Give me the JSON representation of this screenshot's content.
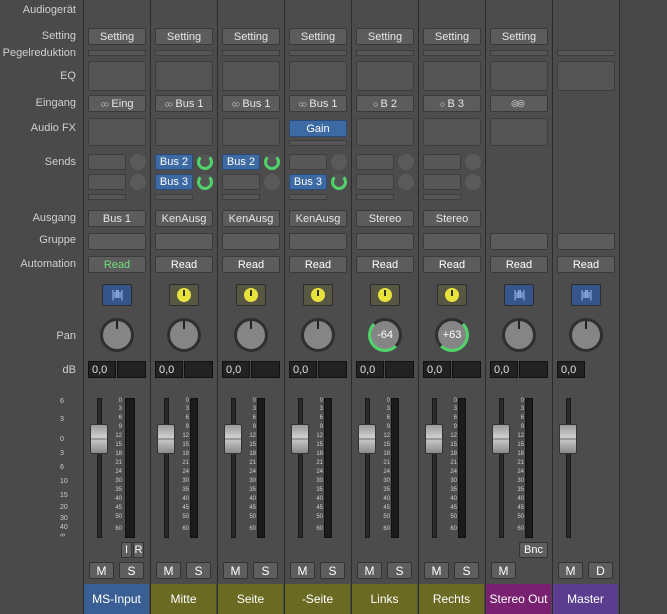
{
  "row_labels": [
    "Audiogerät",
    "Setting",
    "Pegelreduktion",
    "EQ",
    "Eingang",
    "Audio FX",
    "Sends",
    "Ausgang",
    "Gruppe",
    "Automation",
    "Pan",
    "dB"
  ],
  "left_scale": [
    "6",
    "3",
    "0",
    "3",
    "6",
    "10",
    "15",
    "20",
    "30",
    "40",
    "∞"
  ],
  "meter_scale": [
    "0",
    "3",
    "6",
    "9",
    "12",
    "15",
    "18",
    "21",
    "24",
    "30",
    "35",
    "40",
    "45",
    "50",
    "60"
  ],
  "channels": [
    {
      "name": "MS-Input",
      "name_color": "#3a5f95",
      "setting": "Setting",
      "input": "Eing",
      "input_link": "stereo",
      "sends": [],
      "output": "Bus 1",
      "automation": "Read",
      "automation_green": true,
      "plugin": "waveform-icon",
      "pan": "",
      "db": "0,0",
      "m": "M",
      "s": "S",
      "extra1": "I",
      "extra2": "R"
    },
    {
      "name": "Mitte",
      "name_color": "#6a6a22",
      "setting": "Setting",
      "input": "Bus 1",
      "input_link": "linked",
      "sends": [
        "Bus 2",
        "Bus 3"
      ],
      "output": "KenAusg",
      "automation": "Read",
      "automation_green": false,
      "plugin": "tuner-icon",
      "pan": "",
      "db": "0,0",
      "m": "M",
      "s": "S"
    },
    {
      "name": "Seite",
      "name_color": "#6a6a22",
      "setting": "Setting",
      "input": "Bus 1",
      "input_link": "linked",
      "sends": [
        "Bus 2"
      ],
      "output": "KenAusg",
      "automation": "Read",
      "automation_green": false,
      "plugin": "tuner-icon",
      "pan": "",
      "db": "0,0",
      "m": "M",
      "s": "S"
    },
    {
      "name": "-Seite",
      "name_color": "#6a6a22",
      "setting": "Setting",
      "input": "Bus 1",
      "input_link": "linked",
      "sends": [
        "",
        "Bus 3"
      ],
      "output": "KenAusg",
      "automation": "Read",
      "automation_green": false,
      "plugin": "tuner-icon",
      "pan": "",
      "db": "0,0",
      "m": "M",
      "s": "S",
      "fx": "Gain"
    },
    {
      "name": "Links",
      "name_color": "#6a6a22",
      "setting": "Setting",
      "input": "B 2",
      "input_link": "mono",
      "sends": [],
      "output": "Stereo",
      "automation": "Read",
      "automation_green": false,
      "plugin": "tuner-icon",
      "pan": "-64",
      "db": "0,0",
      "m": "M",
      "s": "S"
    },
    {
      "name": "Rechts",
      "name_color": "#6a6a22",
      "setting": "Setting",
      "input": "B 3",
      "input_link": "mono",
      "sends": [],
      "output": "Stereo",
      "automation": "Read",
      "automation_green": false,
      "plugin": "tuner-icon",
      "pan": "+63",
      "db": "0,0",
      "m": "M",
      "s": "S"
    },
    {
      "name": "Stereo Out",
      "name_color": "#7a2070",
      "setting": "Setting",
      "input": "",
      "input_link": "stereo",
      "sends": [],
      "output": "",
      "automation": "Read",
      "automation_green": false,
      "plugin": "waveform-icon",
      "pan": "",
      "db": "0,0",
      "m": "M",
      "s": "",
      "bnc": "Bnc"
    },
    {
      "name": "Master",
      "name_color": "#5b3d8f",
      "setting": "",
      "input": "",
      "sends": [],
      "output": "",
      "automation": "Read",
      "automation_green": false,
      "plugin": "waveform-icon",
      "pan": "",
      "db": "0,0",
      "m": "M",
      "s": "D"
    }
  ]
}
